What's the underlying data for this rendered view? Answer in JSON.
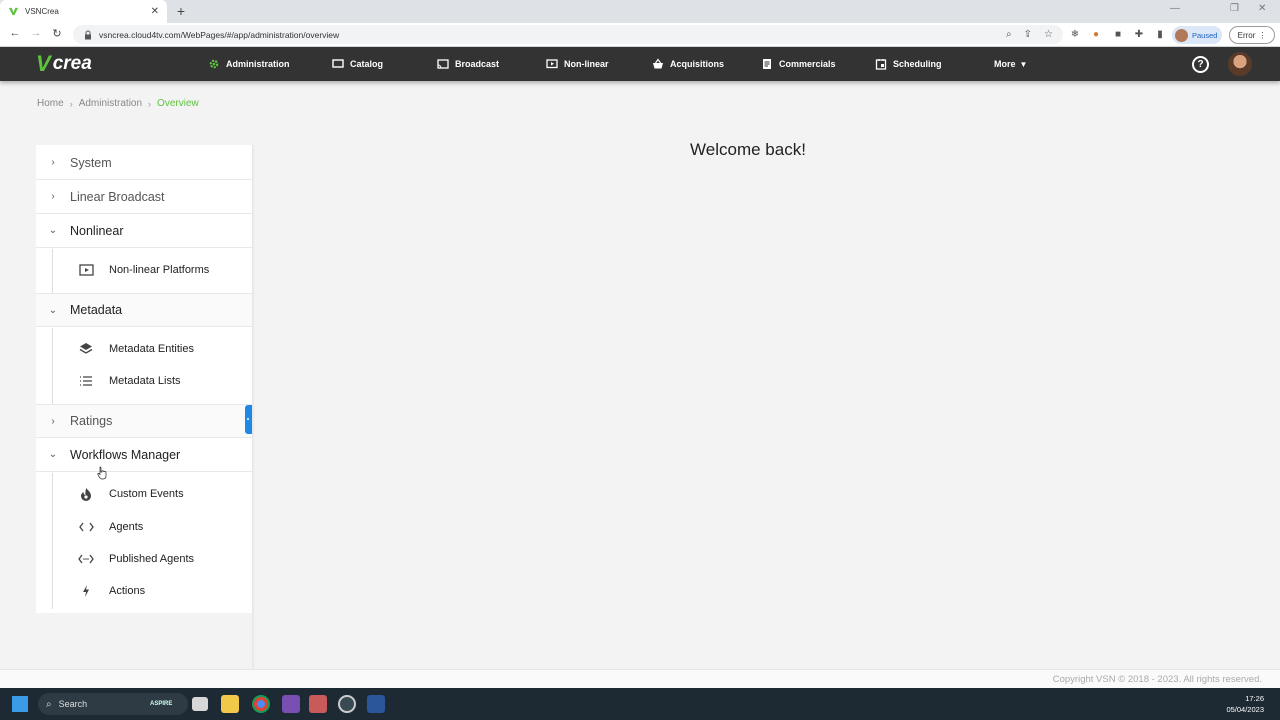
{
  "browser": {
    "tab_title": "VSNCrea",
    "tab_close": "✕",
    "new_tab": "+",
    "url": "vsncrea.cloud4tv.com/WebPages/#/app/administration/overview",
    "profile_status": "Paused",
    "error_label": "Error"
  },
  "app": {
    "logo_v": "V",
    "logo_crea": "crea",
    "nav": [
      {
        "label": "Administration"
      },
      {
        "label": "Catalog"
      },
      {
        "label": "Broadcast"
      },
      {
        "label": "Non-linear"
      },
      {
        "label": "Acquisitions"
      },
      {
        "label": "Commercials"
      },
      {
        "label": "Scheduling"
      },
      {
        "label": "More"
      }
    ],
    "help": "?",
    "accent_color": "#5ec43d"
  },
  "breadcrumb": [
    "Home",
    "Administration",
    "Overview"
  ],
  "sidebar": {
    "sections": [
      {
        "label": "System"
      },
      {
        "label": "Linear Broadcast"
      },
      {
        "label": "Nonlinear"
      },
      {
        "label": "Metadata"
      },
      {
        "label": "Ratings"
      },
      {
        "label": "Workflows Manager"
      }
    ],
    "nonlinear_items": [
      {
        "label": "Non-linear Platforms",
        "icon": "play-screen-icon"
      }
    ],
    "metadata_items": [
      {
        "label": "Metadata Entities",
        "icon": "layers-icon"
      },
      {
        "label": "Metadata Lists",
        "icon": "list-icon"
      }
    ],
    "workflow_items": [
      {
        "label": "Custom Events",
        "icon": "flame-icon"
      },
      {
        "label": "Agents",
        "icon": "code-icon"
      },
      {
        "label": "Published Agents",
        "icon": "code-dots-icon"
      },
      {
        "label": "Actions",
        "icon": "lightning-icon"
      }
    ]
  },
  "main": {
    "welcome": "Welcome back!"
  },
  "footer": {
    "copyright": "Copyright VSN © 2018 - 2023. All rights reserved."
  },
  "taskbar": {
    "search": "Search",
    "brand": "ASPIRE",
    "time": "17:26",
    "date": "05/04/2023"
  }
}
